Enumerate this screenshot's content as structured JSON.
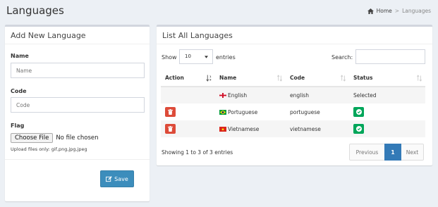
{
  "page": {
    "title": "Languages",
    "breadcrumb": {
      "home": "Home",
      "separator": ">",
      "current": "Languages"
    }
  },
  "add_form": {
    "title": "Add New Language",
    "name_label": "Name",
    "name_placeholder": "Name",
    "code_label": "Code",
    "code_placeholder": "Code",
    "flag_label": "Flag",
    "file_button": "Choose File",
    "file_status": "No file chosen",
    "upload_help": "Upload files only: gif,png,jpg,jpeg",
    "save_label": "Save"
  },
  "list": {
    "title": "List All Languages",
    "show_label": "Show",
    "page_length": "10",
    "entries_label": "entries",
    "search_label": "Search:",
    "columns": [
      "Action",
      "Name",
      "Code",
      "Status"
    ],
    "rows": [
      {
        "name": "English",
        "code": "english",
        "status": "Selected",
        "flag": "gb-flag-icon"
      },
      {
        "name": "Portuguese",
        "code": "portuguese",
        "status": "",
        "flag": "br-flag-icon"
      },
      {
        "name": "Vietnamese",
        "code": "vietnamese",
        "status": "",
        "flag": "vn-flag-icon"
      }
    ],
    "info": "Showing 1 to 3 of 3 entries",
    "pagination": {
      "previous": "Previous",
      "current": "1",
      "next": "Next"
    }
  },
  "colors": {
    "primary": "#3c8dbc",
    "danger": "#dd4b39",
    "success": "#00a65a",
    "page_active": "#337ab7",
    "background": "#ecf0f5"
  }
}
